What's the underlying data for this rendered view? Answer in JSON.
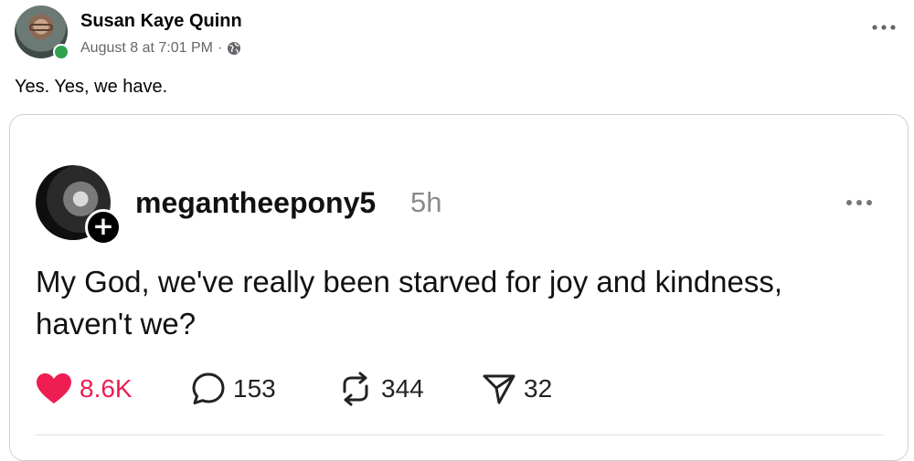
{
  "post": {
    "author": "Susan Kaye Quinn",
    "timestamp": "August 8 at 7:01 PM",
    "separator": "·",
    "audience_icon": "globe-icon",
    "more_icon": "more-options-icon",
    "text": "Yes. Yes, we have."
  },
  "shared_card": {
    "username": "megantheepony5",
    "time_ago": "5h",
    "follow_icon": "plus-icon",
    "more_icon": "more-options-icon",
    "text_line1": "My God, we've really been starved for joy and kindness,",
    "text_line2": "haven't we?",
    "stats": {
      "likes": "8.6K",
      "comments": "153",
      "reposts": "344",
      "shares": "32"
    },
    "colors": {
      "like": "#ee1d52"
    }
  }
}
